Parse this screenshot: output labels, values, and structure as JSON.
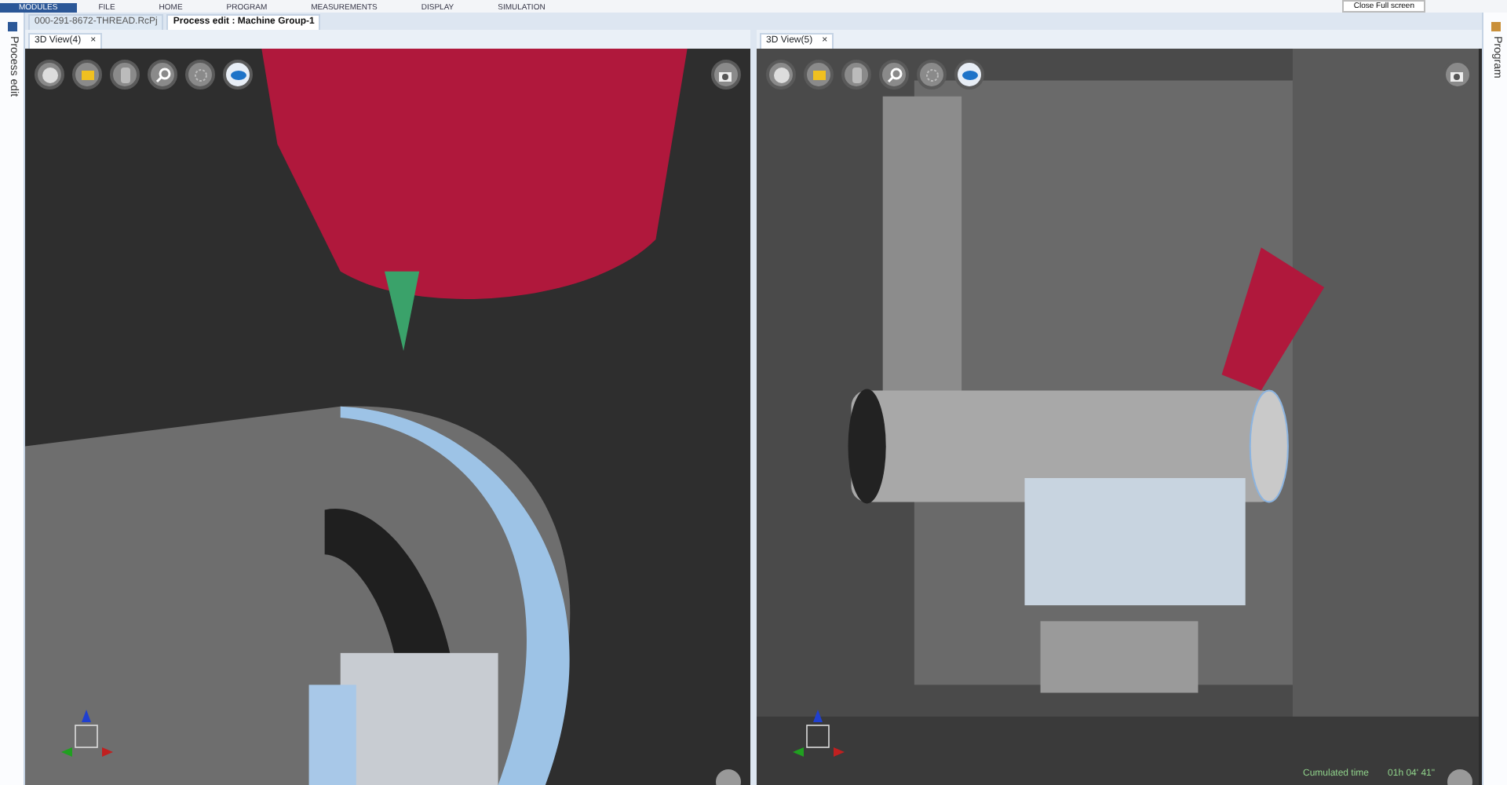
{
  "ribbon": {
    "tabs": [
      {
        "label": "MODULES",
        "selected": true
      },
      {
        "label": "FILE",
        "selected": false
      },
      {
        "label": "HOME",
        "selected": false
      },
      {
        "label": "PROGRAM",
        "selected": false
      },
      {
        "label": "MEASUREMENTS",
        "selected": false
      },
      {
        "label": "DISPLAY",
        "selected": false
      },
      {
        "label": "SIMULATION",
        "selected": false
      }
    ],
    "button": "Close Full screen"
  },
  "left_panel": {
    "label": "Process edit"
  },
  "right_panel": {
    "label": "Program"
  },
  "document_tabs": [
    {
      "label": "000-291-8672-THREAD.RcPj",
      "selected": false
    },
    {
      "label": "Process edit : Machine Group-1",
      "selected": true
    }
  ],
  "views": [
    {
      "title": "3D View(4)",
      "close": "×",
      "kind": "closeup"
    },
    {
      "title": "3D View(5)",
      "close": "×",
      "kind": "overview",
      "status_label": "Cumulated time",
      "status_value": "01h 04' 41\""
    }
  ]
}
